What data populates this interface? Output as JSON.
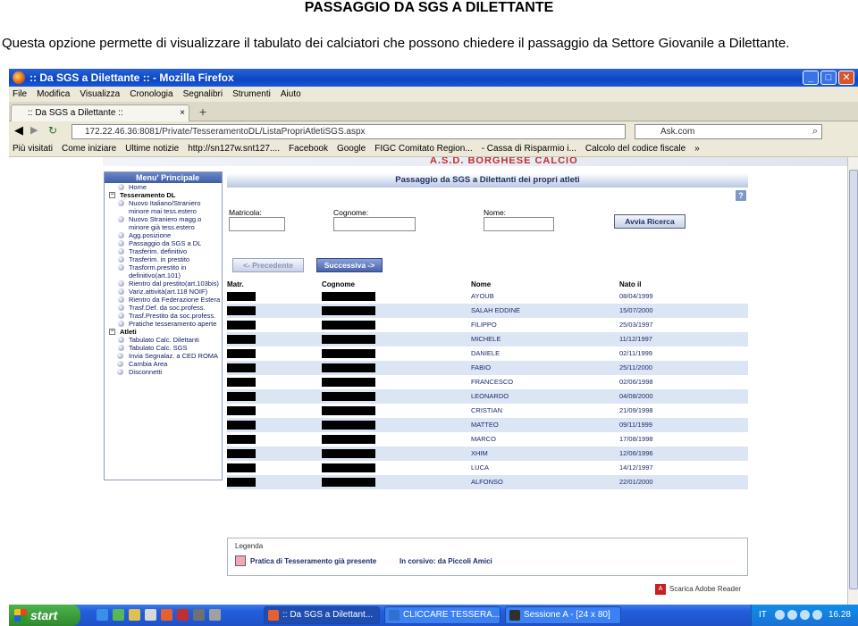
{
  "doc": {
    "title": "PASSAGGIO DA SGS A DILETTANTE",
    "description": "Questa opzione permette di visualizzare il tabulato dei calciatori che possono chiedere il passaggio da Settore Giovanile a Dilettante."
  },
  "window": {
    "title": ":: Da SGS a Dilettante :: - Mozilla Firefox",
    "min": "_",
    "max": "□",
    "close": "✕"
  },
  "menu": [
    "File",
    "Modifica",
    "Visualizza",
    "Cronologia",
    "Segnalibri",
    "Strumenti",
    "Aiuto"
  ],
  "tab": {
    "label": ":: Da SGS a Dilettante ::",
    "close": "×",
    "new": "+"
  },
  "nav": {
    "url": "172.22.46.36:8081/Private/TesseramentoDL/ListaPropriAtletiSGS.aspx",
    "search": "Ask.com"
  },
  "bookmarks": [
    "Più visitati",
    "Come iniziare",
    "Ultime notizie",
    "http://sn127w.snt127....",
    "Facebook",
    "Google",
    "FIGC Comitato Region...",
    "- Cassa di Risparmio i...",
    "Calcolo del codice fiscale",
    "»"
  ],
  "site": {
    "banner": "A.S.D. BORGHESE CALCIO"
  },
  "sidebar": {
    "header": "Menu' Principale",
    "home": "Home",
    "section_tesseramento": "Tesseramento DL",
    "tesseramento_items": [
      "Nuovo Italiano/Straniero minore mai tess.estero",
      "Nuovo Straniero magg.o minore già tess.estero",
      "Agg.posizione",
      "Passaggio da SGS a DL",
      "Trasferim. definitivo",
      "Trasferim. in prestito",
      "Trasform.prestito in definitivo(art.101)",
      "Rientro dal prestito(art.103bis)",
      "Variz.attività(art.118 NOIF)",
      "Rientro da Federazione Estera",
      "Trasf.Def. da soc.profess.",
      "Trasf.Prestito da soc.profess.",
      "Pratiche tesseramento aperte"
    ],
    "section_atleti": "Atleti",
    "atleti_items": [
      "Tabulato Calc. Dilettanti",
      "Tabulato Calc. SGS"
    ],
    "root_items": [
      "Invia Segnalaz. a CED ROMA",
      "Cambia Area",
      "Disconnetti"
    ]
  },
  "panel": {
    "header": "Passaggio da SGS a Dilettanti dei propri atleti",
    "help": "?",
    "matricola_label": "Matricola:",
    "cognome_label": "Cognome:",
    "nome_label": "Nome:",
    "search_button": "Avvia Ricerca",
    "prev_button": "<- Precedente",
    "next_button": "Successiva ->"
  },
  "table": {
    "headers": {
      "matr": "Matr.",
      "cognome": "Cognome",
      "nome": "Nome",
      "nato": "Nato il"
    },
    "rows": [
      {
        "nome": "AYOUB",
        "nato": "08/04/1999"
      },
      {
        "nome": "SALAH EDDINE",
        "nato": "15/07/2000"
      },
      {
        "nome": "FILIPPO",
        "nato": "25/03/1997"
      },
      {
        "nome": "MICHELE",
        "nato": "11/12/1997"
      },
      {
        "nome": "DANIELE",
        "nato": "02/11/1999"
      },
      {
        "nome": "FABIO",
        "nato": "25/11/2000"
      },
      {
        "nome": "FRANCESCO",
        "nato": "02/06/1998"
      },
      {
        "nome": "LEONARDO",
        "nato": "04/08/2000"
      },
      {
        "nome": "CRISTIAN",
        "nato": "21/09/1998"
      },
      {
        "nome": "MATTEO",
        "nato": "09/11/1999"
      },
      {
        "nome": "MARCO",
        "nato": "17/08/1998"
      },
      {
        "nome": "XHIM",
        "nato": "12/06/1996"
      },
      {
        "nome": "LUCA",
        "nato": "14/12/1997"
      },
      {
        "nome": "ALFONSO",
        "nato": "22/01/2000"
      }
    ]
  },
  "legend": {
    "title": "Legenda",
    "item1": "Pratica di Tesseramento già presente",
    "item2": "In corsivo: da Piccoli Amici",
    "swatch_color": "#f3a6b3"
  },
  "adobe": "Scarica Adobe Reader",
  "taskbar": {
    "start": "start",
    "tasks": [
      ":: Da SGS a Dilettant...",
      "CLICCARE TESSERA...",
      "Sessione A - [24 x 80]"
    ],
    "lang": "IT",
    "clock": "16.28"
  }
}
